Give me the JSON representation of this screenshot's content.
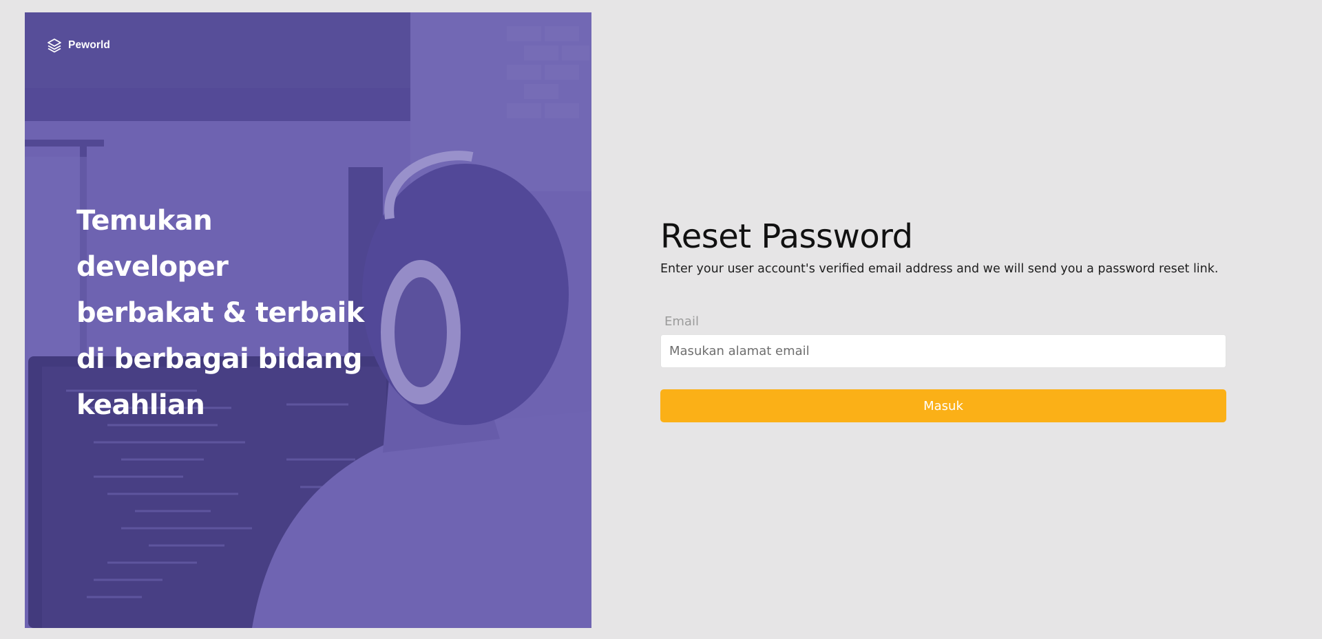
{
  "brand": {
    "name": "Peworld",
    "icon": "layers-icon"
  },
  "hero": {
    "tagline_lines": [
      "Temukan developer",
      "berbakat & terbaik",
      "di berbagai bidang",
      "keahlian"
    ]
  },
  "form": {
    "title": "Reset Password",
    "subtitle": "Enter your user account's verified email address and we will send you a password reset link.",
    "email_label": "Email",
    "email_placeholder": "Masukan alamat email",
    "email_value": "",
    "submit_label": "Masuk"
  },
  "colors": {
    "background": "#e6e5e6",
    "hero_overlay": "#5e50a1",
    "accent_button": "#fbb017"
  }
}
